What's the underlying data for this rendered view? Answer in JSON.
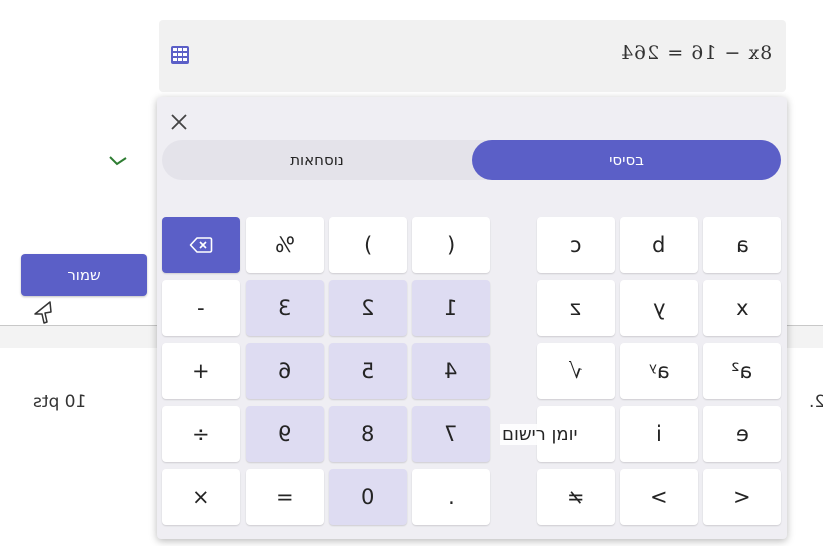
{
  "equation": {
    "text": "8x − 16 = 264",
    "icon": "calculator-icon"
  },
  "save_button": {
    "label": "שמור"
  },
  "question": {
    "points": "10 pts",
    "number": "2."
  },
  "keyboard": {
    "tabs": {
      "formulas": "נוסחאות",
      "basic": "בסיסי"
    },
    "left_keys": [
      [
        "backspace",
        "%",
        ")",
        "("
      ],
      [
        "-",
        "3",
        "2",
        "1"
      ],
      [
        "+",
        "6",
        "5",
        "4"
      ],
      [
        "÷",
        "9",
        "8",
        "7"
      ],
      [
        "×",
        "=",
        "0",
        "."
      ]
    ],
    "right_keys": [
      [
        "c",
        "b",
        "a"
      ],
      [
        "z",
        "y",
        "x"
      ],
      [
        "√",
        "aʸ",
        "a²"
      ],
      [
        "",
        "i",
        "e"
      ],
      [
        "≠",
        ">",
        "<"
      ]
    ],
    "log_label": "יומן רישום"
  },
  "colors": {
    "accent": "#5b5fc7",
    "number_key": "#dedcf2",
    "panel": "#efeef3",
    "check": "#2e7d32"
  }
}
